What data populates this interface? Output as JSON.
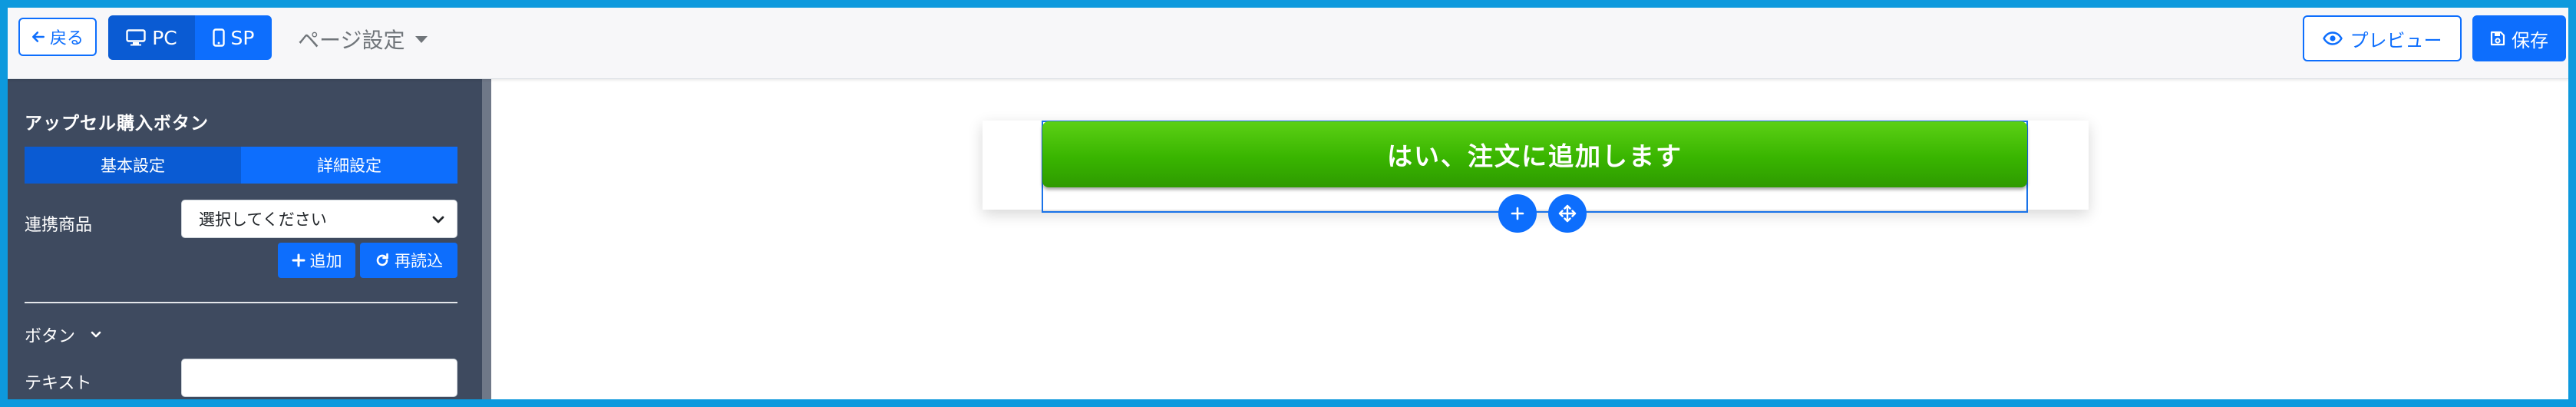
{
  "topbar": {
    "back_label": "戻る",
    "view_pc_label": "PC",
    "view_sp_label": "SP",
    "page_settings_label": "ページ設定",
    "preview_label": "プレビュー",
    "save_label": "保存"
  },
  "sidebar": {
    "panel_title": "アップセル購入ボタン",
    "tabs": [
      {
        "label": "基本設定"
      },
      {
        "label": "詳細設定"
      }
    ],
    "linked_product_label": "連携商品",
    "linked_product_select_value": "選択してください",
    "add_button_label": "追加",
    "reload_button_label": "再読込",
    "button_section_label": "ボタン",
    "text_field_label": "テキスト",
    "text_field_value": ""
  },
  "canvas": {
    "cta_label": "はい、注文に追加します"
  },
  "colors": {
    "frame_border": "#0d99dd",
    "primary": "#0d6efd",
    "sidebar_bg": "#3e4a5f",
    "cta_green": "#39b500"
  },
  "icons": {
    "back": "arrow-left-icon",
    "pc": "desktop-icon",
    "sp": "mobile-icon",
    "page_settings": "caret-down-icon",
    "preview": "eye-icon",
    "save": "floppy-disk-icon",
    "add": "plus-icon",
    "reload": "rotate-icon",
    "section_toggle": "chevron-down-icon",
    "add_block": "plus-icon",
    "move_block": "move-arrows-icon"
  }
}
